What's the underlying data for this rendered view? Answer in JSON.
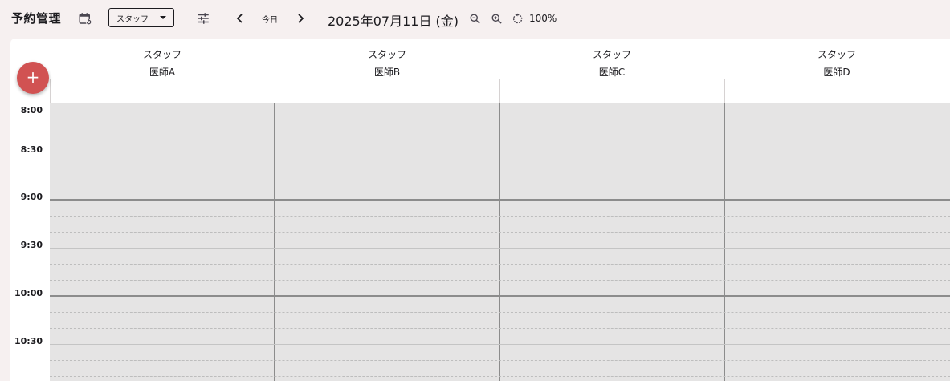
{
  "app": {
    "title": "予約管理"
  },
  "toolbar": {
    "view_select": {
      "value": "スタッフ"
    },
    "today_label": "今日",
    "date": "2025年07月11日 (金)",
    "zoom": "100%",
    "icons": {
      "calendar": "calendar-sync-icon",
      "filter": "tune-icon",
      "prev": "chevron-left-icon",
      "next": "chevron-right-icon",
      "zoom_out": "zoom-out-icon",
      "zoom_in": "zoom-in-icon",
      "reset": "reset-zoom-icon"
    }
  },
  "fab": {
    "label": "+"
  },
  "columns": [
    {
      "role": "スタッフ",
      "name": "医師A"
    },
    {
      "role": "スタッフ",
      "name": "医師B"
    },
    {
      "role": "スタッフ",
      "name": "医師C"
    },
    {
      "role": "スタッフ",
      "name": "医師D"
    }
  ],
  "times": [
    "8:00",
    "8:30",
    "9:00",
    "9:30",
    "10:00",
    "10:30"
  ],
  "colors": {
    "accent": "#d15252",
    "background": "#f6f0f0",
    "slot": "#e5e4e4"
  }
}
